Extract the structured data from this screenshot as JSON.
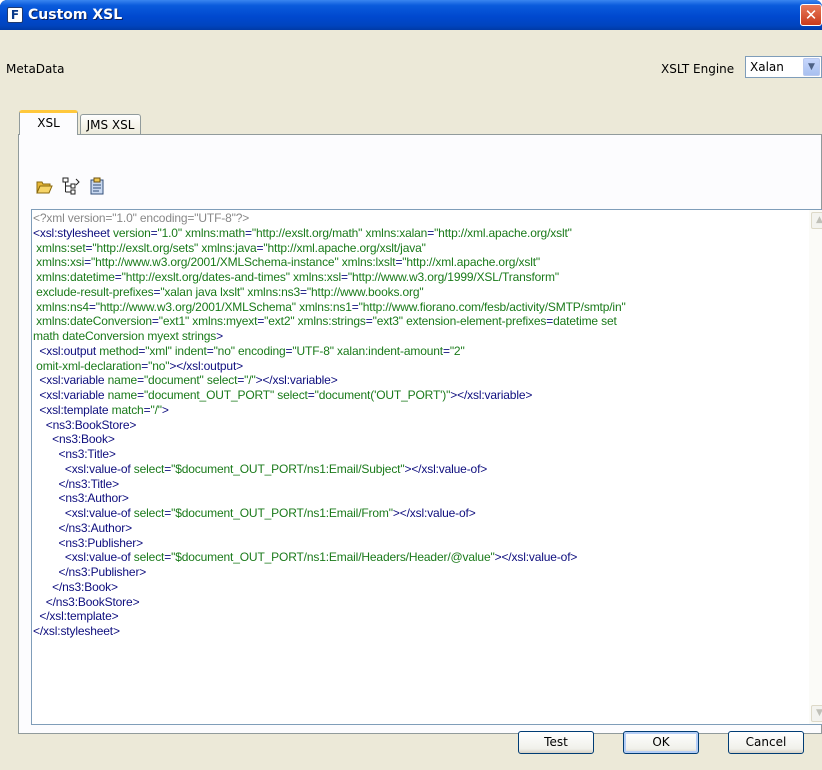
{
  "window": {
    "title": "Custom XSL",
    "app_icon_letter": "F"
  },
  "header": {
    "metadata_label": "MetaData",
    "engine_label": "XSLT Engine",
    "engine_value": "Xalan"
  },
  "tabs": [
    {
      "label": "XSL",
      "selected": true
    },
    {
      "label": "JMS XSL",
      "selected": false
    }
  ],
  "toolbar": {
    "icons": [
      "open-folder-icon",
      "tree-view-icon",
      "paste-icon"
    ]
  },
  "editor": {
    "lines": [
      "<?xml version=\"1.0\" encoding=\"UTF-8\"?>",
      "<xsl:stylesheet version=\"1.0\" xmlns:math=\"http://exslt.org/math\" xmlns:xalan=\"http://xml.apache.org/xslt\"",
      " xmlns:set=\"http://exslt.org/sets\" xmlns:java=\"http://xml.apache.org/xslt/java\"",
      " xmlns:xsi=\"http://www.w3.org/2001/XMLSchema-instance\" xmlns:lxslt=\"http://xml.apache.org/xslt\"",
      " xmlns:datetime=\"http://exslt.org/dates-and-times\" xmlns:xsl=\"http://www.w3.org/1999/XSL/Transform\"",
      " exclude-result-prefixes=\"xalan java lxslt\" xmlns:ns3=\"http://www.books.org\"",
      " xmlns:ns4=\"http://www.w3.org/2001/XMLSchema\" xmlns:ns1=\"http://www.fiorano.com/fesb/activity/SMTP/smtp/in\"",
      " xmlns:dateConversion=\"ext1\" xmlns:myext=\"ext2\" xmlns:strings=\"ext3\" extension-element-prefixes=\"datetime set",
      "math dateConversion myext strings\">",
      "  <xsl:output method=\"xml\" indent=\"no\" encoding=\"UTF-8\" xalan:indent-amount=\"2\"",
      " omit-xml-declaration=\"no\"></xsl:output>",
      "  <xsl:variable name=\"document\" select=\"/\"></xsl:variable>",
      "  <xsl:variable name=\"document_OUT_PORT\" select=\"document('OUT_PORT')\"></xsl:variable>",
      "  <xsl:template match=\"/\">",
      "    <ns3:BookStore>",
      "      <ns3:Book>",
      "        <ns3:Title>",
      "          <xsl:value-of select=\"$document_OUT_PORT/ns1:Email/Subject\"></xsl:value-of>",
      "        </ns3:Title>",
      "        <ns3:Author>",
      "          <xsl:value-of select=\"$document_OUT_PORT/ns1:Email/From\"></xsl:value-of>",
      "        </ns3:Author>",
      "        <ns3:Publisher>",
      "          <xsl:value-of select=\"$document_OUT_PORT/ns1:Email/Headers/Header/@value\"></xsl:value-of>",
      "        </ns3:Publisher>",
      "      </ns3:Book>",
      "    </ns3:BookStore>",
      "  </xsl:template>",
      "</xsl:stylesheet>"
    ]
  },
  "buttons": {
    "test": "Test",
    "ok": "OK",
    "cancel": "Cancel"
  },
  "colors": {
    "titlebar": "#0049cf",
    "element": "#0e0e7e",
    "attribute": "#8a1a8a",
    "value": "#1a7a1a",
    "prolog": "#888888",
    "tab_highlight": "#ffc83c"
  }
}
